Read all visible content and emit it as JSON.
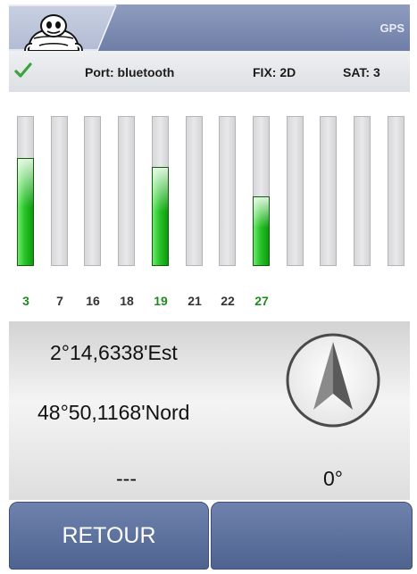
{
  "header": {
    "title": "GPS",
    "logo_icon": "michelin-man-logo-icon",
    "colors": {
      "bar": "#7b8ab1",
      "tab": "#c0c8dc"
    }
  },
  "status": {
    "ok_icon": "check-icon",
    "port": "Port: bluetooth",
    "fix": "FIX: 2D",
    "sat": "SAT: 3"
  },
  "satellites": [
    {
      "id": "3",
      "level": 0.73,
      "active": true
    },
    {
      "id": "7",
      "level": 0,
      "active": false
    },
    {
      "id": "16",
      "level": 0,
      "active": false
    },
    {
      "id": "18",
      "level": 0,
      "active": false
    },
    {
      "id": "19",
      "level": 0.67,
      "active": true
    },
    {
      "id": "21",
      "level": 0,
      "active": false
    },
    {
      "id": "22",
      "level": 0,
      "active": false
    },
    {
      "id": "27",
      "level": 0.47,
      "active": true
    },
    {
      "id": "",
      "level": 0,
      "active": false
    },
    {
      "id": "",
      "level": 0,
      "active": false
    },
    {
      "id": "",
      "level": 0,
      "active": false
    },
    {
      "id": "",
      "level": 0,
      "active": false
    }
  ],
  "position": {
    "longitude": "2°14,6338'Est",
    "latitude": "48°50,1168'Nord",
    "altitude": "---",
    "heading": "0°",
    "compass_icon": "compass-arrow-icon"
  },
  "buttons": {
    "back_label": "RETOUR",
    "second_label": ""
  },
  "colors": {
    "signal_green": "#29c429",
    "active_label": "#1f8a1f",
    "button": "#5d719c"
  }
}
